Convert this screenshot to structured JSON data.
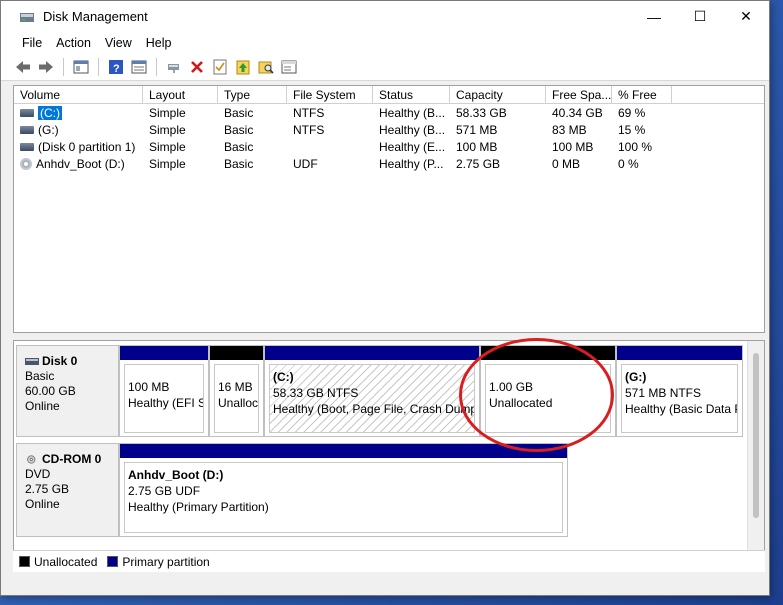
{
  "window": {
    "title": "Disk Management",
    "minimize_glyph": "—",
    "maximize_glyph": "☐",
    "close_glyph": "✕"
  },
  "menu": [
    "File",
    "Action",
    "View",
    "Help"
  ],
  "toolbar": [
    {
      "icon": "back-arrow-icon"
    },
    {
      "icon": "forward-arrow-icon"
    },
    {
      "icon": "properties-panel-icon"
    },
    {
      "icon": "help-icon"
    },
    {
      "icon": "disk-list-icon"
    },
    {
      "icon": "connect-icon"
    },
    {
      "icon": "delete-icon"
    },
    {
      "icon": "check-icon"
    },
    {
      "icon": "import-icon"
    },
    {
      "icon": "search-folder-icon"
    },
    {
      "icon": "settings-panel-icon"
    }
  ],
  "volume_table": {
    "columns": [
      "Volume",
      "Layout",
      "Type",
      "File System",
      "Status",
      "Capacity",
      "Free Spa...",
      "% Free"
    ],
    "rows": [
      {
        "volume": "(C:)",
        "layout": "Simple",
        "type": "Basic",
        "fs": "NTFS",
        "status": "Healthy (B...",
        "capacity": "58.33 GB",
        "free": "40.34 GB",
        "pct": "69 %",
        "icon": "drive-icon",
        "selected": true
      },
      {
        "volume": "(G:)",
        "layout": "Simple",
        "type": "Basic",
        "fs": "NTFS",
        "status": "Healthy (B...",
        "capacity": "571 MB",
        "free": "83 MB",
        "pct": "15 %",
        "icon": "drive-icon",
        "selected": false
      },
      {
        "volume": "(Disk 0 partition 1)",
        "layout": "Simple",
        "type": "Basic",
        "fs": "",
        "status": "Healthy (E...",
        "capacity": "100 MB",
        "free": "100 MB",
        "pct": "100 %",
        "icon": "drive-icon",
        "selected": false
      },
      {
        "volume": "Anhdv_Boot (D:)",
        "layout": "Simple",
        "type": "Basic",
        "fs": "UDF",
        "status": "Healthy (P...",
        "capacity": "2.75 GB",
        "free": "0 MB",
        "pct": "0 %",
        "icon": "cd-drive-icon",
        "selected": false
      }
    ]
  },
  "disks": [
    {
      "name": "Disk 0",
      "type": "Basic",
      "size": "60.00 GB",
      "state": "Online",
      "partitions": [
        {
          "line1": "",
          "line2": "100 MB",
          "line3": "Healthy (EFI Sy",
          "kind": "primary"
        },
        {
          "line1": "",
          "line2": "16 MB",
          "line3": "Unalloc",
          "kind": "unallocated"
        },
        {
          "line1": "(C:)",
          "line2": "58.33 GB NTFS",
          "line3": "Healthy (Boot, Page File, Crash Dump,",
          "kind": "primary-hatched"
        },
        {
          "line1": "",
          "line2": "1.00 GB",
          "line3": "Unallocated",
          "kind": "unallocated"
        },
        {
          "line1": "(G:)",
          "line2": "571 MB NTFS",
          "line3": "Healthy (Basic Data P",
          "kind": "primary"
        }
      ]
    },
    {
      "name": "CD-ROM 0",
      "type": "DVD",
      "size": "2.75 GB",
      "state": "Online",
      "partitions": [
        {
          "line1": "Anhdv_Boot  (D:)",
          "line2": "2.75 GB UDF",
          "line3": "Healthy (Primary Partition)",
          "kind": "primary"
        }
      ]
    }
  ],
  "legend": [
    {
      "label": "Unallocated",
      "color": "#000000"
    },
    {
      "label": "Primary partition",
      "color": "#00008b"
    }
  ],
  "colors": {
    "primary_bar": "#00008b",
    "unallocated_bar": "#000000",
    "selection": "#0078d7",
    "highlight_circle": "#d81e1e"
  }
}
